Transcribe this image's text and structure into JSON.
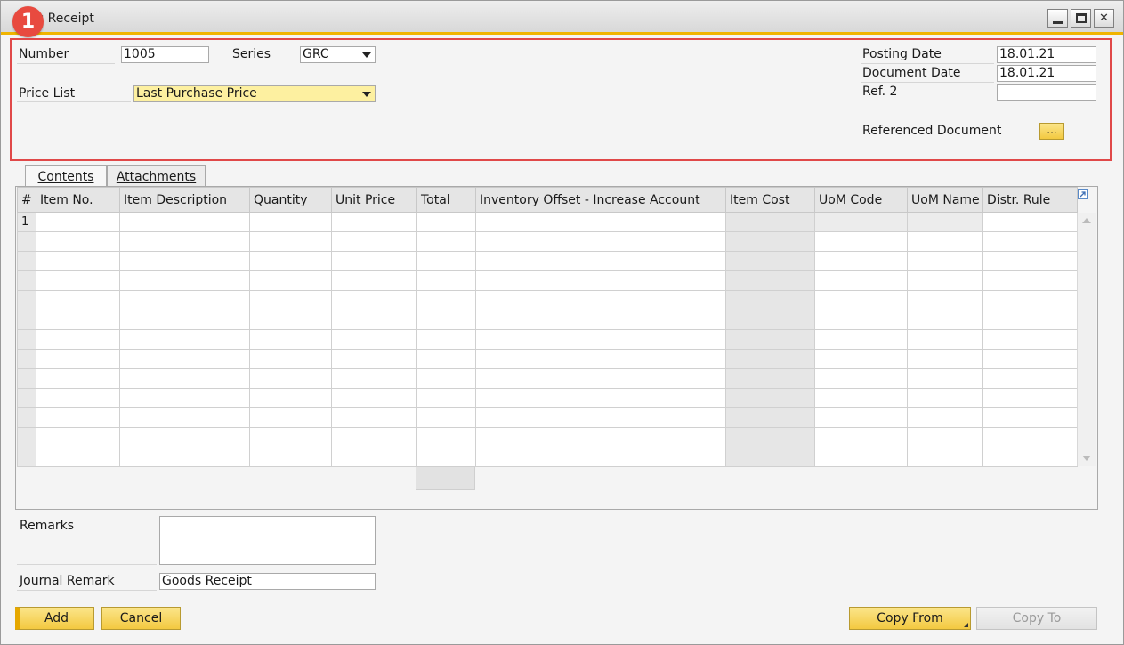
{
  "window": {
    "title": "ds Receipt",
    "step_badge": "1"
  },
  "header": {
    "number_label": "Number",
    "number_value": "1005",
    "series_label": "Series",
    "series_value": "GRC",
    "price_list_label": "Price List",
    "price_list_value": "Last Purchase Price",
    "posting_date_label": "Posting Date",
    "posting_date_value": "18.01.21",
    "document_date_label": "Document Date",
    "document_date_value": "18.01.21",
    "ref2_label": "Ref. 2",
    "ref2_value": "",
    "referenced_document_label": "Referenced Document",
    "referenced_document_button": "..."
  },
  "tabs": {
    "contents": "Contents",
    "attachments": "Attachments"
  },
  "grid": {
    "columns": [
      "#",
      "Item No.",
      "Item Description",
      "Quantity",
      "Unit Price",
      "Total",
      "Inventory Offset - Increase Account",
      "Item Cost",
      "UoM Code",
      "UoM Name",
      "Distr. Rule"
    ],
    "rows": [
      "1",
      "",
      "",
      "",
      "",
      "",
      "",
      "",
      "",
      "",
      "",
      "",
      ""
    ]
  },
  "footer": {
    "remarks_label": "Remarks",
    "remarks_value": "",
    "journal_remark_label": "Journal Remark",
    "journal_remark_value": "Goods Receipt"
  },
  "buttons": {
    "add": "Add",
    "cancel": "Cancel",
    "copy_from": "Copy From",
    "copy_to": "Copy To"
  },
  "colors": {
    "accent": "#f0b400",
    "button_yellow": "#f3c940",
    "highlight_red": "#e04848",
    "field_yellow": "#fdf0a0"
  }
}
